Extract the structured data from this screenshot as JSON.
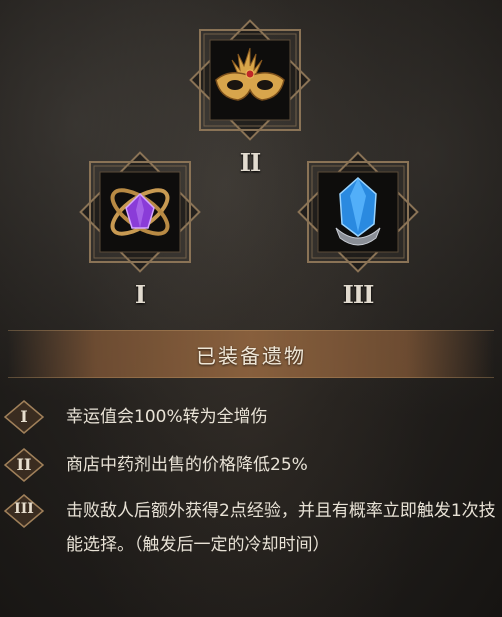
{
  "relics": [
    {
      "numeral": "II",
      "icon": "golden-masquerade-mask-icon"
    },
    {
      "numeral": "I",
      "icon": "purple-gem-orb-icon"
    },
    {
      "numeral": "III",
      "icon": "blue-crystal-icon"
    }
  ],
  "section_title": "已装备遗物",
  "effects": [
    {
      "numeral": "I",
      "text": "幸运值会100%转为全增伤"
    },
    {
      "numeral": "II",
      "text": "商店中药剂出售的价格降低25%"
    },
    {
      "numeral": "III",
      "text": "击败敌人后额外获得2点经验，并且有概率立即触发1次技能选择。（触发后一定的冷却时间）"
    }
  ],
  "colors": {
    "frame": "#8a7356",
    "banner": "#8c623e",
    "text": "#e8e2d6"
  }
}
